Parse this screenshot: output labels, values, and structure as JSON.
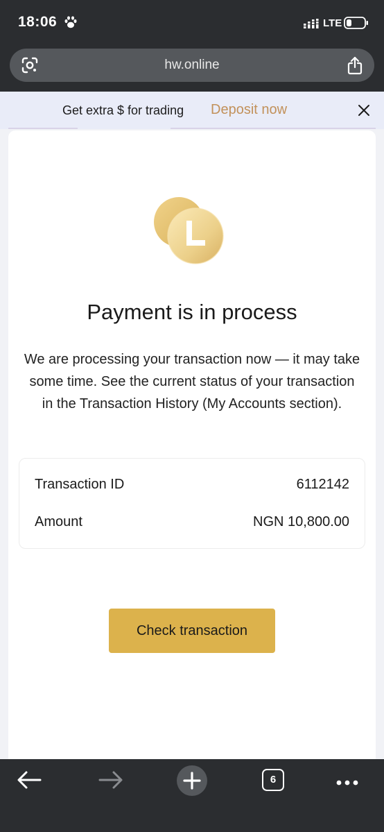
{
  "status_bar": {
    "time": "18:06",
    "network": "LTE"
  },
  "browser": {
    "url": "hw.online",
    "tab_count": "6"
  },
  "banner": {
    "text": "Get extra $ for trading",
    "link": "Deposit now"
  },
  "payment": {
    "title": "Payment is in process",
    "description": "We are processing your transaction now — it may take some time. See the current status of your transaction in the Transaction History (My Accounts section).",
    "details": [
      {
        "label": "Transaction ID",
        "value": "6112142"
      },
      {
        "label": "Amount",
        "value": "NGN 10,800.00"
      }
    ],
    "button": "Check transaction"
  },
  "colors": {
    "accent_gold": "#dcb24c",
    "deposit_link": "#c2915a",
    "banner_bg": "#e9ecf8",
    "browser_chrome": "#2b2d30"
  },
  "icons": [
    "paw-icon",
    "signal-icon",
    "battery-icon",
    "google-lens-icon",
    "share-icon",
    "close-icon",
    "coin-icon",
    "back-arrow-icon",
    "forward-arrow-icon",
    "new-tab-icon",
    "more-menu-icon"
  ]
}
